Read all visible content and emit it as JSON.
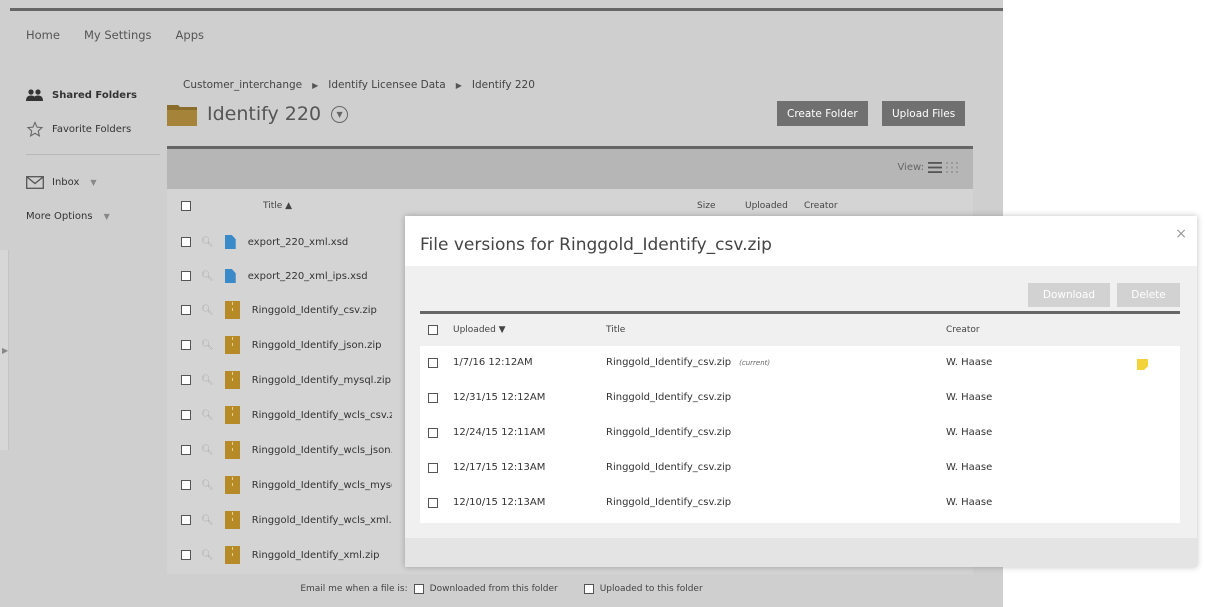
{
  "topnav": [
    "Home",
    "My Settings",
    "Apps"
  ],
  "sidebar": {
    "shared_folders": "Shared Folders",
    "favorite_folders": "Favorite Folders",
    "inbox": "Inbox",
    "more_options": "More Options"
  },
  "breadcrumb": [
    "Customer_interchange",
    "Identify Licensee Data",
    "Identify 220"
  ],
  "folder": {
    "title": "Identify 220"
  },
  "toolbar": {
    "create_folder": "Create Folder",
    "upload_files": "Upload Files"
  },
  "listview": {
    "view_label": "View:"
  },
  "filelist": {
    "columns": {
      "title": "Title ▲",
      "size": "Size",
      "uploaded": "Uploaded",
      "creator": "Creator"
    },
    "files": [
      {
        "name": "export_220_xml.xsd",
        "icon": "xsd-file-icon"
      },
      {
        "name": "export_220_xml_ips.xsd",
        "icon": "xsd-file-icon"
      },
      {
        "name": "Ringgold_Identify_csv.zip",
        "icon": "zip-file-icon"
      },
      {
        "name": "Ringgold_Identify_json.zip",
        "icon": "zip-file-icon"
      },
      {
        "name": "Ringgold_Identify_mysql.zip",
        "icon": "zip-file-icon"
      },
      {
        "name": "Ringgold_Identify_wcls_csv.zip",
        "icon": "zip-file-icon"
      },
      {
        "name": "Ringgold_Identify_wcls_json.zip",
        "icon": "zip-file-icon"
      },
      {
        "name": "Ringgold_Identify_wcls_mysql.zip",
        "icon": "zip-file-icon"
      },
      {
        "name": "Ringgold_Identify_wcls_xml.zip",
        "icon": "zip-file-icon"
      },
      {
        "name": "Ringgold_Identify_xml.zip",
        "icon": "zip-file-icon"
      }
    ]
  },
  "email_notify": {
    "label": "Email me when a file is:",
    "downloaded": "Downloaded from this folder",
    "uploaded": "Uploaded to this folder"
  },
  "modal": {
    "title": "File versions for Ringgold_Identify_csv.zip",
    "close": "×",
    "download": "Download",
    "delete": "Delete",
    "columns": {
      "uploaded": "Uploaded ▼",
      "title": "Title",
      "creator": "Creator"
    },
    "current_tag": "(current)",
    "versions": [
      {
        "uploaded": "1/7/16 12:12AM",
        "title": "Ringgold_Identify_csv.zip",
        "creator": "W. Haase",
        "current": true
      },
      {
        "uploaded": "12/31/15 12:12AM",
        "title": "Ringgold_Identify_csv.zip",
        "creator": "W. Haase",
        "current": false
      },
      {
        "uploaded": "12/24/15 12:11AM",
        "title": "Ringgold_Identify_csv.zip",
        "creator": "W. Haase",
        "current": false
      },
      {
        "uploaded": "12/17/15 12:13AM",
        "title": "Ringgold_Identify_csv.zip",
        "creator": "W. Haase",
        "current": false
      },
      {
        "uploaded": "12/10/15 12:13AM",
        "title": "Ringgold_Identify_csv.zip",
        "creator": "W. Haase",
        "current": false
      }
    ]
  },
  "colors": {
    "folder": "#8a6d2a",
    "zip": "#b68a26",
    "xsd": "#3a89c9",
    "note": "#f2d33a",
    "dark_button": "#707070"
  }
}
